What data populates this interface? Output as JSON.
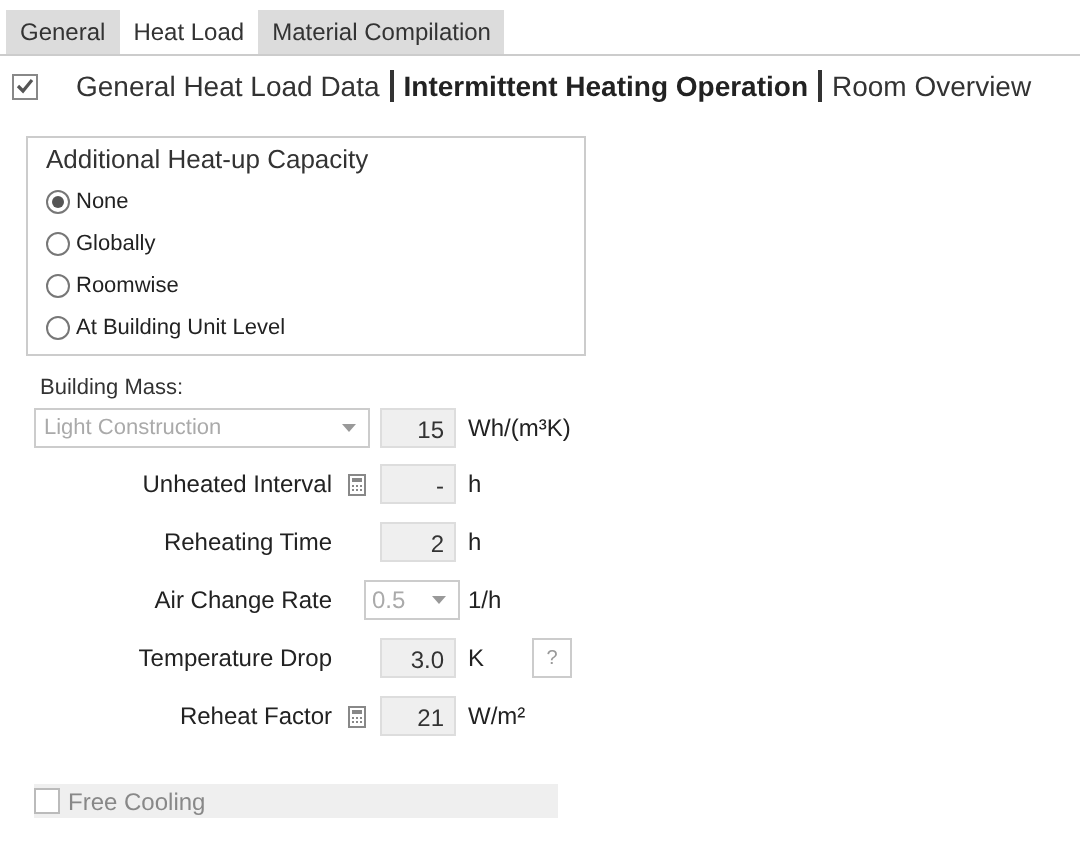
{
  "tabs": [
    {
      "label": "General",
      "selected": false
    },
    {
      "label": "Heat Load",
      "selected": true
    },
    {
      "label": "Material Compilation",
      "selected": false
    }
  ],
  "header": {
    "checked": true,
    "sections": [
      {
        "label": "General Heat Load Data",
        "selected": false
      },
      {
        "label": "Intermittent Heating Operation",
        "selected": true
      },
      {
        "label": "Room Overview",
        "selected": false
      }
    ]
  },
  "heatup": {
    "title": "Additional Heat-up Capacity",
    "options": [
      {
        "label": "None",
        "selected": true
      },
      {
        "label": "Globally",
        "selected": false
      },
      {
        "label": "Roomwise",
        "selected": false
      },
      {
        "label": "At Building Unit Level",
        "selected": false
      }
    ]
  },
  "building_mass": {
    "label": "Building Mass:",
    "dropdown": "Light Construction",
    "value": "15",
    "unit": "Wh/(m³K)"
  },
  "rows": [
    {
      "kind": "field",
      "label": "Unheated Interval",
      "calculator": true,
      "value": "-",
      "unit": "h"
    },
    {
      "kind": "field",
      "label": "Reheating Time",
      "calculator": false,
      "value": "2",
      "unit": "h"
    },
    {
      "kind": "dropdown",
      "label": "Air Change Rate",
      "calculator": false,
      "value": "0.5",
      "unit": "1/h"
    },
    {
      "kind": "field",
      "label": "Temperature Drop",
      "calculator": false,
      "value": "3.0",
      "unit": "K",
      "help": "?"
    },
    {
      "kind": "field",
      "label": "Reheat Factor",
      "calculator": true,
      "value": "21",
      "unit": "W/m²"
    }
  ],
  "free_cooling": {
    "label": "Free Cooling",
    "checked": false
  }
}
